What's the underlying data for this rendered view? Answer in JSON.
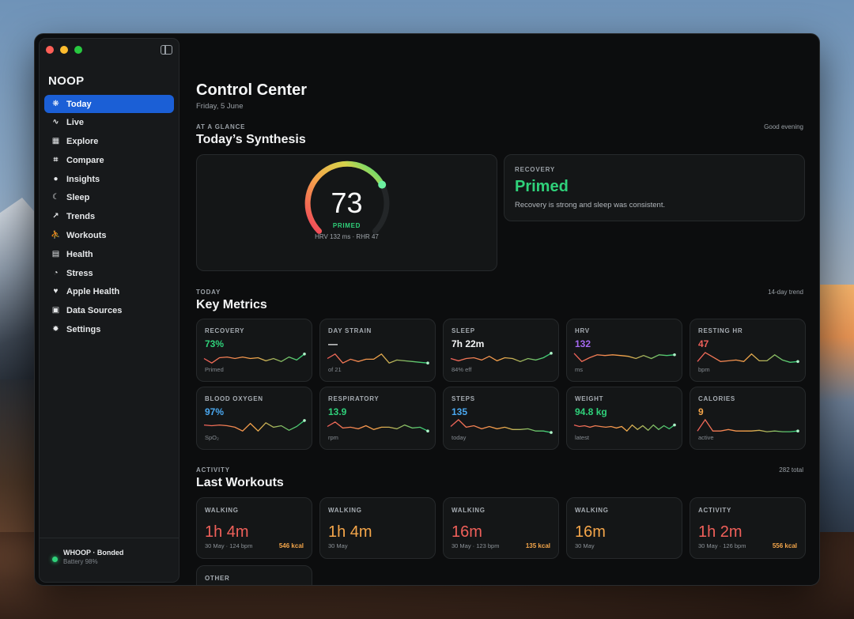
{
  "colors": {
    "accent": "#1b5fd6",
    "green": "#2fd17a",
    "red": "#f0605a",
    "orange": "#f5a64a",
    "purple": "#a569f0",
    "blue": "#4aa8f0",
    "white": "#f5f6f7"
  },
  "window": {
    "controls": [
      "close",
      "minimize",
      "zoom"
    ]
  },
  "sidebar": {
    "app_name": "NOOP",
    "items": [
      {
        "label": "Today",
        "icon": "paw-icon",
        "active": true
      },
      {
        "label": "Live",
        "icon": "pulse-icon"
      },
      {
        "label": "Explore",
        "icon": "grid-icon"
      },
      {
        "label": "Compare",
        "icon": "chart-compare-icon"
      },
      {
        "label": "Insights",
        "icon": "lightbulb-icon"
      },
      {
        "label": "Sleep",
        "icon": "moon-icon"
      },
      {
        "label": "Trends",
        "icon": "trend-icon"
      },
      {
        "label": "Workouts",
        "icon": "runner-icon"
      },
      {
        "label": "Health",
        "icon": "clipboard-icon"
      },
      {
        "label": "Stress",
        "icon": "gauge-icon"
      },
      {
        "label": "Apple Health",
        "icon": "heart-icon"
      },
      {
        "label": "Data Sources",
        "icon": "bag-icon"
      },
      {
        "label": "Settings",
        "icon": "gear-icon"
      }
    ],
    "device": {
      "name": "WHOOP · Bonded",
      "battery": "Battery 98%"
    }
  },
  "header": {
    "title": "Control Center",
    "date": "Friday, 5 June"
  },
  "glance": {
    "eyebrow": "AT A GLANCE",
    "title": "Today’s Synthesis",
    "greeting": "Good evening",
    "gauge": {
      "value": "73",
      "progress": 0.73,
      "state": "PRIMED",
      "detail": "HRV 132 ms · RHR 47"
    },
    "recovery": {
      "eyebrow": "RECOVERY",
      "title": "Primed",
      "description": "Recovery is strong and sleep was consistent."
    }
  },
  "metrics": {
    "eyebrow": "TODAY",
    "title": "Key Metrics",
    "aside": "14-day trend",
    "items": [
      {
        "label": "RECOVERY",
        "value": "73%",
        "sub": "Primed",
        "color": "#2fd17a",
        "spark": [
          0.5,
          0.2,
          0.55,
          0.6,
          0.5,
          0.6,
          0.5,
          0.55,
          0.35,
          0.5,
          0.3,
          0.6,
          0.4,
          0.8
        ]
      },
      {
        "label": "DAY STRAIN",
        "value": "—",
        "sub": "of 21",
        "color": "#f5f6f7",
        "spark": [
          0.5,
          0.8,
          0.2,
          0.45,
          0.3,
          0.45,
          0.45,
          0.8,
          0.2,
          0.4,
          0.35,
          0.3,
          0.25,
          0.2
        ]
      },
      {
        "label": "SLEEP",
        "value": "7h 22m",
        "sub": "84% eff",
        "color": "#f5f6f7",
        "spark": [
          0.5,
          0.35,
          0.5,
          0.55,
          0.4,
          0.65,
          0.35,
          0.55,
          0.5,
          0.3,
          0.5,
          0.4,
          0.55,
          0.85
        ]
      },
      {
        "label": "HRV",
        "value": "132",
        "sub": "ms",
        "color": "#a569f0",
        "spark": [
          0.85,
          0.3,
          0.55,
          0.75,
          0.7,
          0.75,
          0.7,
          0.65,
          0.5,
          0.7,
          0.5,
          0.75,
          0.7,
          0.75
        ]
      },
      {
        "label": "RESTING HR",
        "value": "47",
        "sub": "bpm",
        "color": "#f0605a",
        "spark": [
          0.3,
          0.9,
          0.6,
          0.3,
          0.35,
          0.4,
          0.3,
          0.8,
          0.35,
          0.35,
          0.75,
          0.4,
          0.25,
          0.3
        ]
      },
      {
        "label": "BLOOD OXYGEN",
        "value": "97%",
        "sub": "SpO₂",
        "color": "#4aa8f0",
        "spark": [
          0.6,
          0.55,
          0.6,
          0.55,
          0.45,
          0.2,
          0.7,
          0.2,
          0.75,
          0.45,
          0.55,
          0.25,
          0.5,
          0.9
        ]
      },
      {
        "label": "RESPIRATORY",
        "value": "13.9",
        "sub": "rpm",
        "color": "#2fd17a",
        "spark": [
          0.5,
          0.8,
          0.4,
          0.45,
          0.35,
          0.55,
          0.3,
          0.45,
          0.45,
          0.35,
          0.6,
          0.4,
          0.45,
          0.2
        ]
      },
      {
        "label": "STEPS",
        "value": "135",
        "sub": "today",
        "color": "#4aa8f0",
        "spark": [
          0.5,
          0.95,
          0.45,
          0.55,
          0.35,
          0.5,
          0.35,
          0.45,
          0.3,
          0.3,
          0.35,
          0.2,
          0.2,
          0.1
        ]
      },
      {
        "label": "WEIGHT",
        "value": "94.8 kg",
        "sub": "latest",
        "color": "#2fd17a",
        "spark": [
          0.6,
          0.5,
          0.55,
          0.45,
          0.55,
          0.5,
          0.45,
          0.5,
          0.4,
          0.5,
          0.2,
          0.6,
          0.3,
          0.55,
          0.25,
          0.6,
          0.3,
          0.55,
          0.35,
          0.6
        ]
      },
      {
        "label": "CALORIES",
        "value": "9",
        "sub": "active",
        "color": "#f5a64a",
        "spark": [
          0.2,
          0.95,
          0.2,
          0.2,
          0.3,
          0.2,
          0.2,
          0.2,
          0.25,
          0.15,
          0.2,
          0.15,
          0.15,
          0.2
        ]
      }
    ]
  },
  "workouts": {
    "eyebrow": "ACTIVITY",
    "title": "Last Workouts",
    "aside": "282 total",
    "items": [
      {
        "label": "WALKING",
        "duration": "1h 4m",
        "sub": "30 May · 124 bpm",
        "kcal": "546 kcal",
        "color": "#f0605a"
      },
      {
        "label": "WALKING",
        "duration": "1h 4m",
        "sub": "30 May",
        "kcal": "",
        "color": "#f5a64a"
      },
      {
        "label": "WALKING",
        "duration": "16m",
        "sub": "30 May · 123 bpm",
        "kcal": "135 kcal",
        "color": "#f0605a"
      },
      {
        "label": "WALKING",
        "duration": "16m",
        "sub": "30 May",
        "kcal": "",
        "color": "#f5a64a"
      },
      {
        "label": "ACTIVITY",
        "duration": "1h 2m",
        "sub": "30 May · 126 bpm",
        "kcal": "556 kcal",
        "color": "#f0605a"
      }
    ],
    "other_label": "OTHER"
  }
}
